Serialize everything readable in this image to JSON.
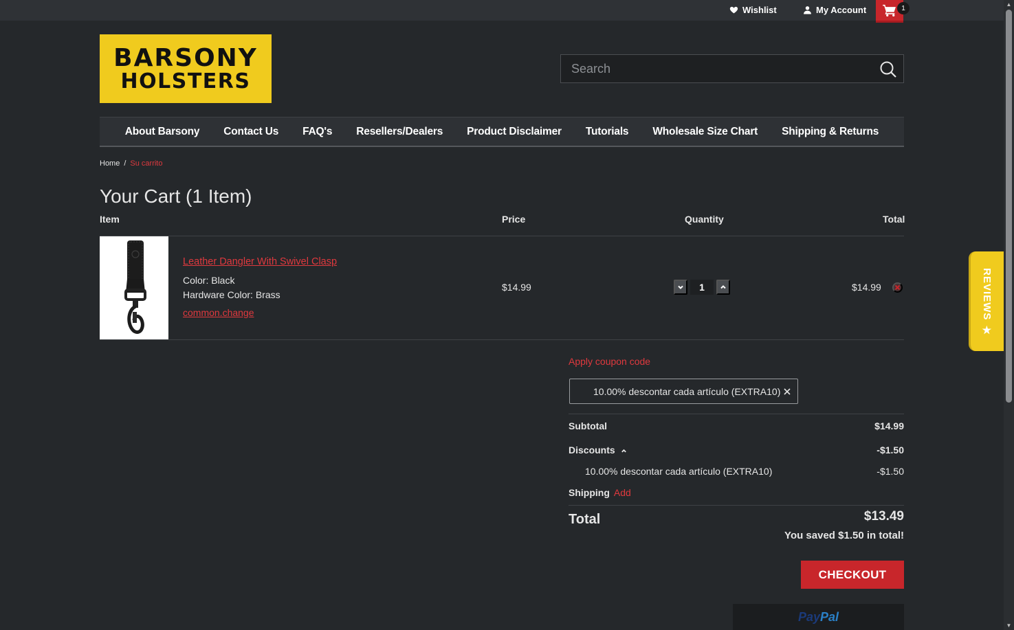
{
  "topbar": {
    "wishlist_label": "Wishlist",
    "account_label": "My Account",
    "cart_count": "1"
  },
  "logo": {
    "line1": "BARSONY",
    "line2": "HOLSTERS"
  },
  "search": {
    "placeholder": "Search"
  },
  "nav": {
    "items": [
      "About Barsony",
      "Contact Us",
      "FAQ's",
      "Resellers/Dealers",
      "Product Disclaimer",
      "Tutorials",
      "Wholesale Size Chart",
      "Shipping & Returns"
    ]
  },
  "breadcrumb": {
    "home": "Home",
    "separator": "/",
    "current": "Su carrito"
  },
  "cart": {
    "title": "Your Cart (1 Item)",
    "headers": {
      "item": "Item",
      "price": "Price",
      "quantity": "Quantity",
      "total": "Total"
    },
    "items": [
      {
        "name": "Leather Dangler With Swivel Clasp",
        "options": [
          "Color: Black",
          "Hardware Color: Brass"
        ],
        "change_label": "common.change",
        "price": "$14.99",
        "quantity": "1",
        "total": "$14.99"
      }
    ]
  },
  "coupon": {
    "link_label": "Apply coupon code",
    "applied": "10.00% descontar cada artículo (EXTRA10)"
  },
  "totals": {
    "subtotal_label": "Subtotal",
    "subtotal_value": "$14.99",
    "discounts_label": "Discounts",
    "discounts_value": "-$1.50",
    "discount_line_label": "10.00% descontar cada artículo (EXTRA10)",
    "discount_line_value": "-$1.50",
    "shipping_label": "Shipping",
    "shipping_action": "Add",
    "total_label": "Total",
    "total_value": "$13.49",
    "saved_text": "You saved $1.50 in total!"
  },
  "checkout_label": "CHECKOUT",
  "paypal": {
    "part1": "Pay",
    "part2": "Pal"
  },
  "reviews_tab": {
    "label": "REVIEWS"
  },
  "colors": {
    "background": "#25282b",
    "accent_red": "#c8262b",
    "link_red": "#e0393e",
    "logo_yellow": "#f0cb1e"
  }
}
